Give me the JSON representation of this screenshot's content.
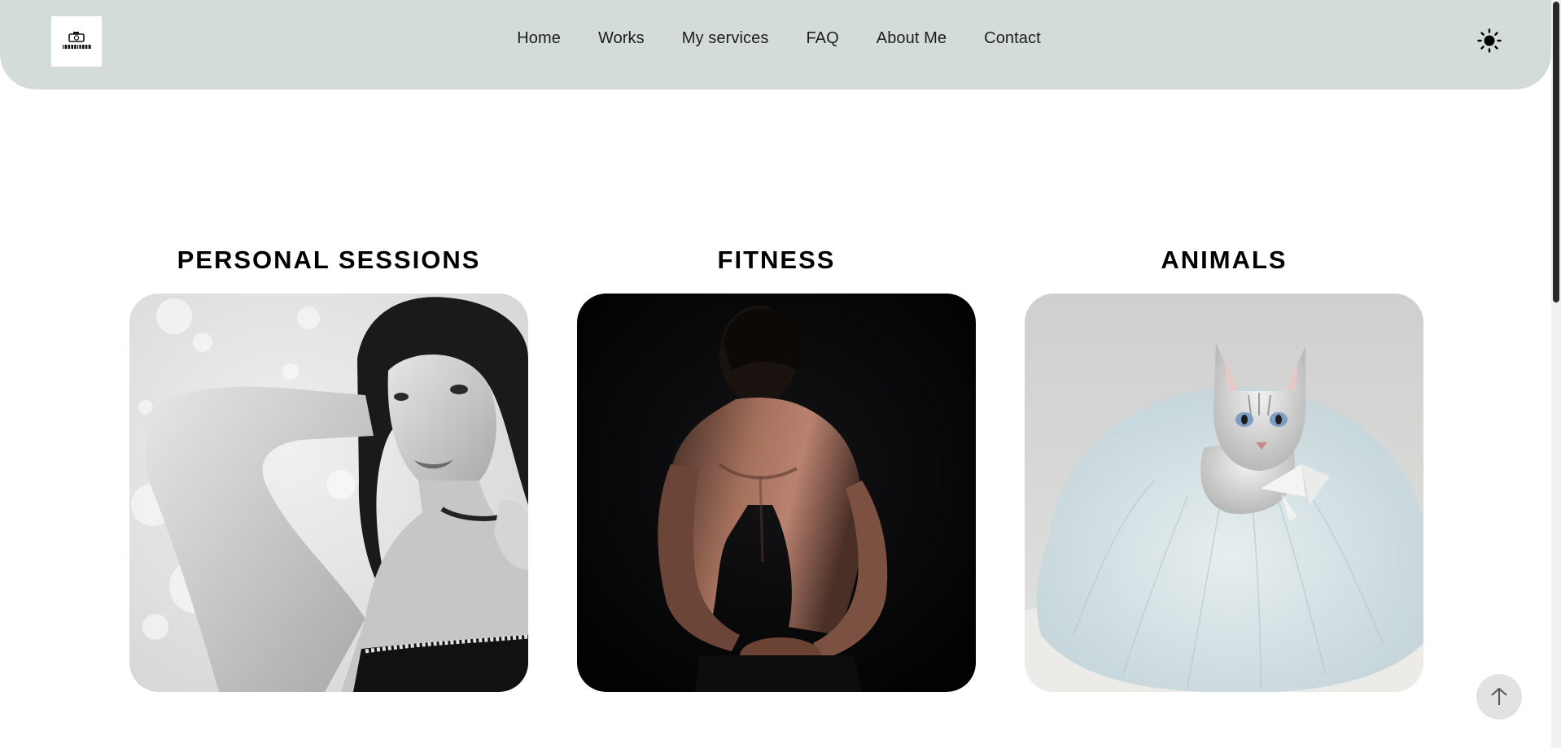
{
  "header": {
    "logo_text": "LOREM IPSUM",
    "nav": [
      {
        "label": "Home"
      },
      {
        "label": "Works"
      },
      {
        "label": "My services"
      },
      {
        "label": "FAQ"
      },
      {
        "label": "About Me"
      },
      {
        "label": "Contact"
      }
    ],
    "theme_icon": "sun-icon",
    "background_color": "#d4dcd9"
  },
  "categories": [
    {
      "title": "PERSONAL SESSIONS",
      "image": "portrait-photo"
    },
    {
      "title": "FITNESS",
      "image": "fitness-photo"
    },
    {
      "title": "ANIMALS",
      "image": "cat-photo"
    }
  ],
  "scroll_top_icon": "arrow-up-icon"
}
